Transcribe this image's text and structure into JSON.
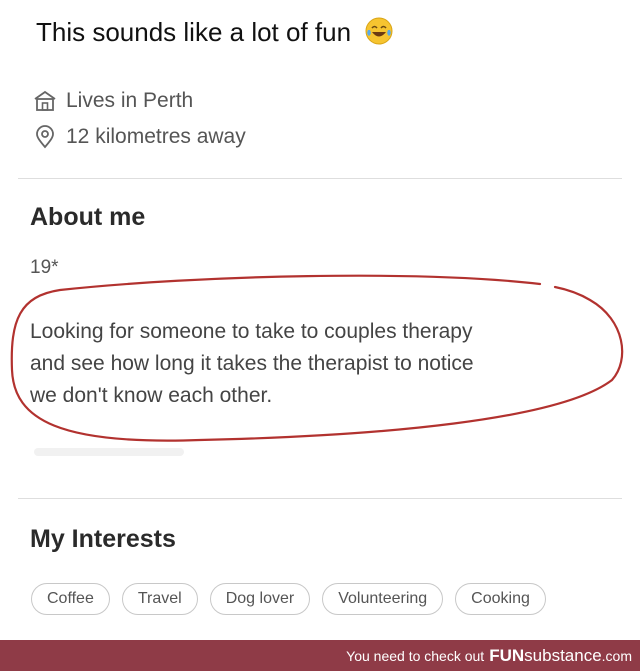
{
  "caption": {
    "text": "This sounds like a lot of fun",
    "emoji": "laughing-crying-emoji"
  },
  "profile": {
    "lives_in": "Lives in Perth",
    "distance": "12 kilometres away"
  },
  "about": {
    "title": "About me",
    "age": "19*",
    "bio_lines": [
      "Looking for someone to take to couples therapy",
      "and see how  long it takes the therapist to notice",
      "we don't know each other."
    ],
    "annotation_color": "#b2322f"
  },
  "interests": {
    "title": "My Interests",
    "items": [
      "Coffee",
      "Travel",
      "Dog lover",
      "Volunteering",
      "Cooking"
    ]
  },
  "footer": {
    "text": "You need to check out",
    "brand_bold": "FUN",
    "brand_rest": "substance",
    "brand_domain": ".com",
    "color": "#8f3b47"
  }
}
